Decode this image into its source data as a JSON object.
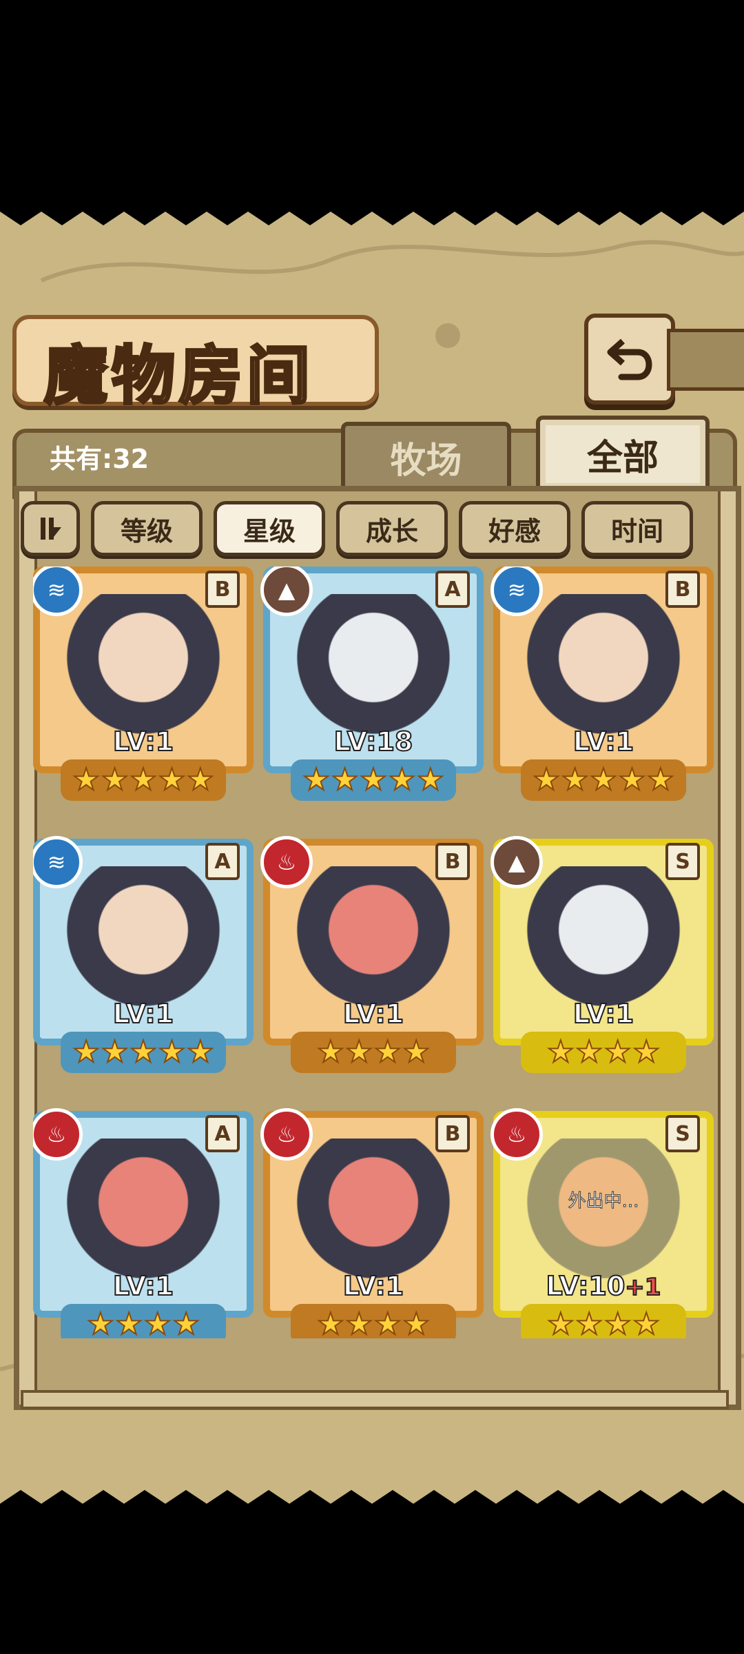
{
  "header": {
    "title": "魔物房间",
    "back_icon": "back-arrow-icon"
  },
  "summary": {
    "count_label": "共有:32"
  },
  "tabs": [
    {
      "label": "牧场",
      "active": false
    },
    {
      "label": "全部",
      "active": true
    }
  ],
  "sort_buttons": [
    {
      "label": "等级",
      "active": false
    },
    {
      "label": "星级",
      "active": true
    },
    {
      "label": "成长",
      "active": false
    },
    {
      "label": "好感",
      "active": false
    },
    {
      "label": "时间",
      "active": false
    }
  ],
  "colors": {
    "panel_bg": "#c9b682",
    "frame_gold": "#d08a2c",
    "frame_blue": "#5fa5c9",
    "frame_yellow": "#e6cf1a",
    "element_water": "#2a79c0",
    "element_fire": "#c2272d",
    "element_earth": "#6e4a3a"
  },
  "monsters": [
    {
      "element": "water",
      "rank": "B",
      "level": "LV:1",
      "stars": 5,
      "frame": "gold",
      "status": ""
    },
    {
      "element": "earth",
      "rank": "A",
      "level": "LV:18",
      "stars": 5,
      "frame": "blue",
      "status": ""
    },
    {
      "element": "water",
      "rank": "B",
      "level": "LV:1",
      "stars": 5,
      "frame": "gold",
      "status": ""
    },
    {
      "element": "water",
      "rank": "A",
      "level": "LV:1",
      "stars": 5,
      "frame": "blue",
      "status": ""
    },
    {
      "element": "fire",
      "rank": "B",
      "level": "LV:1",
      "stars": 4,
      "frame": "gold",
      "status": ""
    },
    {
      "element": "earth",
      "rank": "S",
      "level": "LV:1",
      "stars": 4,
      "frame": "yellow",
      "status": ""
    },
    {
      "element": "fire",
      "rank": "A",
      "level": "LV:1",
      "stars": 4,
      "frame": "blue",
      "status": ""
    },
    {
      "element": "fire",
      "rank": "B",
      "level": "LV:1",
      "stars": 4,
      "frame": "gold",
      "status": ""
    },
    {
      "element": "fire",
      "rank": "S",
      "level": "LV:10",
      "level_bonus": "+1",
      "stars": 4,
      "frame": "yellow",
      "status": "外出中..."
    }
  ]
}
